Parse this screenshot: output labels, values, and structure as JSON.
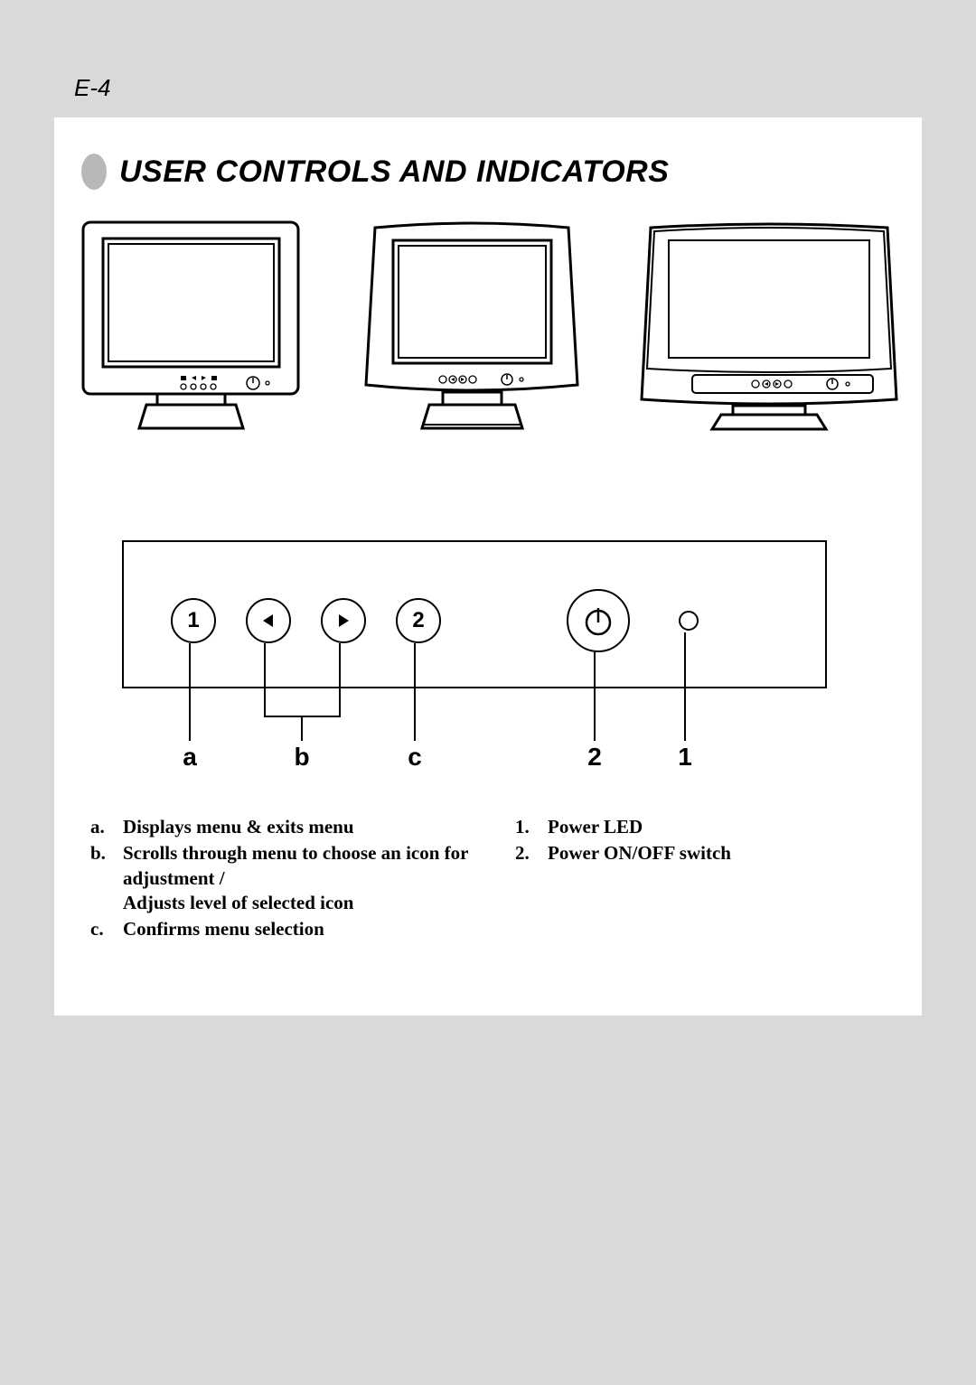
{
  "page_number": "E-4",
  "title": "USER CONTROLS AND INDICATORS",
  "panel": {
    "button1": "1",
    "button2": "2",
    "labels": {
      "a": "a",
      "b": "b",
      "c": "c",
      "two": "2",
      "one": "1"
    }
  },
  "descriptions_left": [
    {
      "key": "a.",
      "text": "Displays menu & exits menu"
    },
    {
      "key": "b.",
      "text": "Scrolls through menu to choose an icon for adjustment /\nAdjusts level of selected icon"
    },
    {
      "key": "c.",
      "text": "Confirms menu selection"
    }
  ],
  "descriptions_right": [
    {
      "key": "1.",
      "text": "Power LED"
    },
    {
      "key": "2.",
      "text": "Power ON/OFF switch"
    }
  ]
}
